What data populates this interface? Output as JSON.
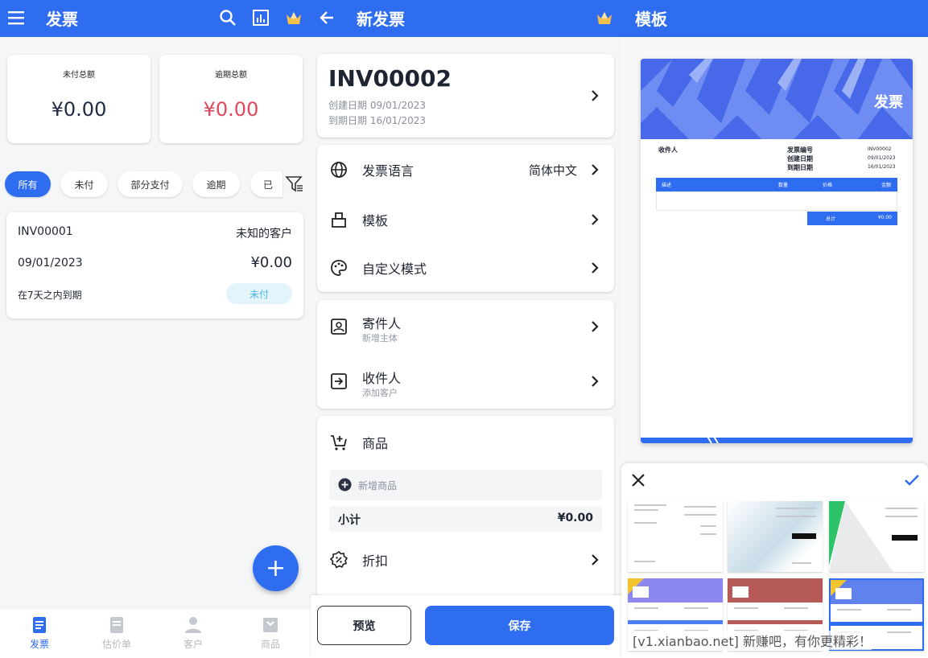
{
  "colors": {
    "primary": "#2f6df0",
    "danger": "#e0475d",
    "text": "#1f2433",
    "muted": "#9096a3",
    "badge_bg": "#e3f4fb",
    "badge_text": "#4fb6de"
  },
  "screen1": {
    "title": "发票",
    "icons": [
      "menu-icon",
      "search-icon",
      "report-icon",
      "crown-icon"
    ],
    "summary": [
      {
        "label": "未付总额",
        "value": "¥0.00"
      },
      {
        "label": "逾期总额",
        "value": "¥0.00"
      }
    ],
    "filters": [
      "所有",
      "未付",
      "部分支付",
      "逾期",
      "已"
    ],
    "invoice": {
      "number": "INV00001",
      "customer": "未知的客户",
      "date": "09/01/2023",
      "amount": "¥0.00",
      "due": "在7天之内到期",
      "status": "未付"
    },
    "fab": "+",
    "nav": [
      "发票",
      "估价单",
      "客户",
      "商品"
    ]
  },
  "screen2": {
    "title": "新发票",
    "invoice_number": "INV00002",
    "created": "创建日期 09/01/2023",
    "due": "到期日期 16/01/2023",
    "language_label": "发票语言",
    "language_value": "简体中文",
    "template_label": "模板",
    "custom_label": "自定义模式",
    "sender_label": "寄件人",
    "sender_sub": "新增主体",
    "recipient_label": "收件人",
    "recipient_sub": "添加客户",
    "items_label": "商品",
    "add_item": "新增商品",
    "subtotal_label": "小计",
    "subtotal_value": "¥0.00",
    "discount_label": "折扣",
    "preview_button": "预览",
    "save_button": "保存"
  },
  "screen3": {
    "title": "模板",
    "preview": {
      "banner_title": "发票",
      "recipient": "收件人",
      "meta_labels": [
        "发票编号",
        "创建日期",
        "到期日期"
      ],
      "meta_values": [
        "INV00002",
        "09/01/2023",
        "16/01/2023"
      ],
      "columns": [
        "描述",
        "数量",
        "价格",
        "金额"
      ],
      "total_label": "总计",
      "total_value": "¥0.00"
    },
    "watermark": "[v1.xianbao.net] 新赚吧，有你更精彩！"
  }
}
